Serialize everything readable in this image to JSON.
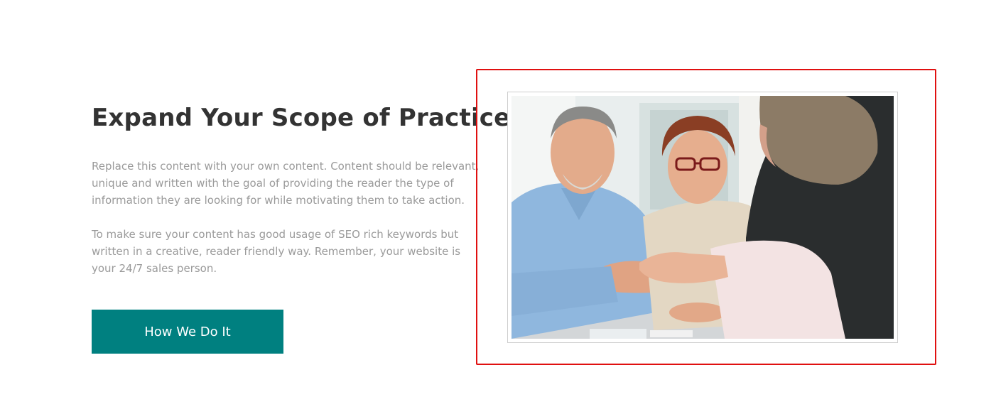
{
  "section": {
    "heading": "Expand Your Scope of Practice",
    "paragraphs": [
      "Replace this content with your own content. Content should be relevant, unique and written with the goal of providing the reader the type of information they are looking for while motivating them to take action.",
      "To make sure your content has good usage of SEO rich keywords but written in a creative, reader friendly way. Remember, your website is your 24/7 sales person."
    ],
    "button_label": "How We Do It"
  },
  "colors": {
    "button_bg": "#008080",
    "heading": "#333333",
    "body_text": "#9a9a9a",
    "highlight_border": "#e01010"
  },
  "image": {
    "subject": "senior-couple-handshake-photo"
  }
}
